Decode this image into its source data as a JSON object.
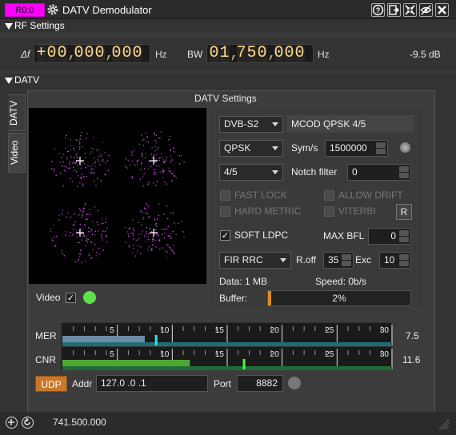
{
  "window": {
    "channel_badge": "R0:0",
    "title": "DATV Demodulator",
    "icons": [
      "help-icon",
      "move-to-workspace-icon",
      "shrink-icon",
      "hide-icon",
      "close-icon"
    ]
  },
  "rf_settings": {
    "header": "RF Settings",
    "df_label": "Δf",
    "df_digits": [
      "+",
      "0",
      "0",
      ",",
      "0",
      "0",
      "0",
      ",",
      "0",
      "0",
      "0"
    ],
    "df_unit": "Hz",
    "bw_label": "BW",
    "bw_digits": [
      "0",
      "1",
      ",",
      "7",
      "5",
      "0",
      ",",
      "0",
      "0",
      "0"
    ],
    "bw_unit": "Hz",
    "power": "-9.5 dB"
  },
  "datv": {
    "header": "DATV",
    "tabs": [
      "DATV",
      "Video"
    ],
    "settings_title": "DATV Settings",
    "standard": "DVB-S2",
    "modcod": "MCOD QPSK 4/5",
    "modulation": "QPSK",
    "symrate_label": "Sym/s",
    "symrate": "1500000",
    "fec": "4/5",
    "notch_label": "Notch filter",
    "notch": "0",
    "fast_lock": "FAST LOCK",
    "allow_drift": "ALLOW DRIFT",
    "hard_metric": "HARD METRIC",
    "viterbi": "VITERBI",
    "reset_button": "R",
    "soft_ldpc": "SOFT LDPC",
    "soft_ldpc_checked": true,
    "max_bfl_label": "MAX BFL",
    "max_bfl": "0",
    "filter": "FIR RRC",
    "roff_label": "R.off",
    "roff": "35",
    "exc_label": "Exc",
    "exc": "10",
    "data_label": "Data: 1 MB",
    "speed_label": "Speed: 0b/s",
    "buffer_label": "Buffer:",
    "buffer_value": "2%",
    "buffer_fraction": 0.02,
    "video_label": "Video",
    "video_checked": true,
    "video_status_color": "#5fe04a"
  },
  "meters": {
    "ticks": [
      "5",
      "10",
      "15",
      "20",
      "25",
      "30"
    ],
    "mer": {
      "label": "MER",
      "value": "7.5",
      "avg": 7.5,
      "peak": 8.5
    },
    "cnr": {
      "label": "CNR",
      "value": "11.6",
      "avg": 11.6,
      "peak": 16.5
    }
  },
  "udp": {
    "button": "UDP",
    "addr_label": "Addr",
    "addr": "127.0 .0 .1",
    "port_label": "Port",
    "port": "8882"
  },
  "status": {
    "frequency": "741.500.000"
  }
}
